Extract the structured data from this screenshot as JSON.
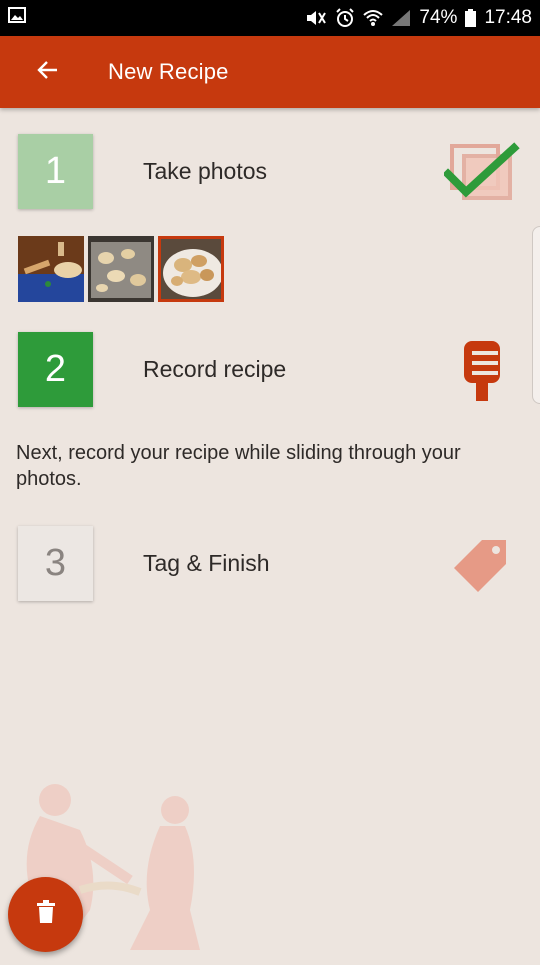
{
  "status_bar": {
    "battery": "74%",
    "time": "17:48"
  },
  "toolbar": {
    "title": "New Recipe",
    "back_icon": "arrow-back-icon"
  },
  "steps": [
    {
      "number": "1",
      "label": "Take photos",
      "icon": "photos-done-icon",
      "color": "#a9cfa5"
    },
    {
      "number": "2",
      "label": "Record recipe",
      "icon": "microphone-icon",
      "color": "#2e9b3a"
    },
    {
      "number": "3",
      "label": "Tag & Finish",
      "icon": "tag-icon",
      "color": "#ece7e3"
    }
  ],
  "hint": "Next, record your recipe while sliding through your photos.",
  "thumbnails": [
    {
      "name": "photo-1",
      "selected": false
    },
    {
      "name": "photo-2",
      "selected": false
    },
    {
      "name": "photo-3",
      "selected": true
    }
  ],
  "fab": {
    "icon": "trash-icon"
  },
  "colors": {
    "accent": "#c6390e",
    "background": "#ede5df",
    "done_green": "#2e9b3a"
  }
}
